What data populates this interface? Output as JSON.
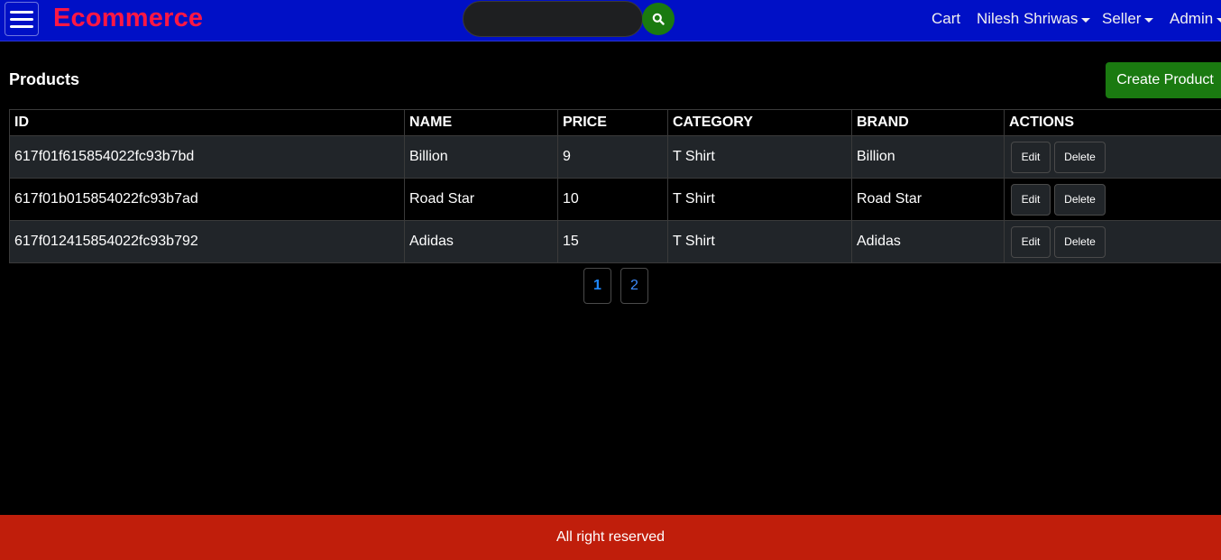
{
  "header": {
    "brand": "Ecommerce",
    "search": {
      "value": "",
      "placeholder": ""
    },
    "nav": {
      "cart": "Cart",
      "user": "Nilesh Shriwas",
      "seller": "Seller",
      "admin": "Admin"
    }
  },
  "main": {
    "title": "Products",
    "create_label": "Create Product",
    "table": {
      "headers": [
        "ID",
        "NAME",
        "PRICE",
        "CATEGORY",
        "BRAND",
        "ACTIONS"
      ],
      "rows": [
        {
          "id": "617f01f615854022fc93b7bd",
          "name": "Billion",
          "price": "9",
          "category": "T Shirt",
          "brand": "Billion"
        },
        {
          "id": "617f01b015854022fc93b7ad",
          "name": "Road Star",
          "price": "10",
          "category": "T Shirt",
          "brand": "Road Star"
        },
        {
          "id": "617f012415854022fc93b792",
          "name": "Adidas",
          "price": "15",
          "category": "T Shirt",
          "brand": "Adidas"
        }
      ],
      "edit_label": "Edit",
      "delete_label": "Delete"
    },
    "pagination": {
      "pages": [
        "1",
        "2"
      ],
      "active": "1"
    }
  },
  "footer": {
    "text": "All right reserved"
  },
  "colors": {
    "header_bg": "#0010c6",
    "brand": "#ff1744",
    "accent_green": "#1a7a10",
    "footer_bg": "#c01e0b",
    "row_alt": "#212529",
    "page_link": "#3d8bfd"
  },
  "icons": {
    "menu": "hamburger-icon",
    "search": "search-icon",
    "dropdown": "caret-down-icon"
  }
}
